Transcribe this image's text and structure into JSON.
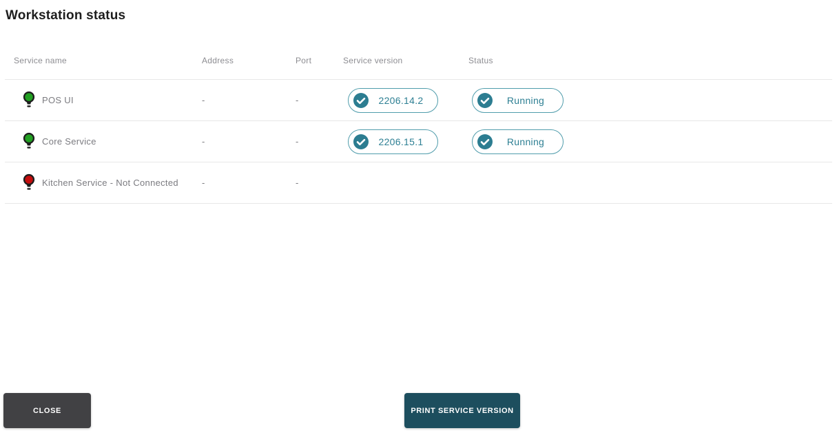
{
  "title": "Workstation status",
  "colors": {
    "teal": "#2c7d91",
    "badge_border": "#4f9cab",
    "bulb_green": "#22a022",
    "bulb_red": "#c40d0d",
    "close_bg": "#414144",
    "print_bg": "#1d4e5e"
  },
  "table": {
    "headers": [
      "Service name",
      "Address",
      "Port",
      "Service version",
      "Status"
    ],
    "rows": [
      {
        "name": "POS UI",
        "bulb": "green",
        "bulb_color": "#22a022",
        "address": "-",
        "port": "-",
        "version": "2206.14.2",
        "status": "Running"
      },
      {
        "name": "Core Service",
        "bulb": "green",
        "bulb_color": "#22a022",
        "address": "-",
        "port": "-",
        "version": "2206.15.1",
        "status": "Running"
      },
      {
        "name": "Kitchen Service - Not Connected",
        "bulb": "red",
        "bulb_color": "#c40d0d",
        "address": "-",
        "port": "-"
      }
    ]
  },
  "footer": {
    "close": "CLOSE",
    "print": "PRINT SERVICE VERSION"
  }
}
